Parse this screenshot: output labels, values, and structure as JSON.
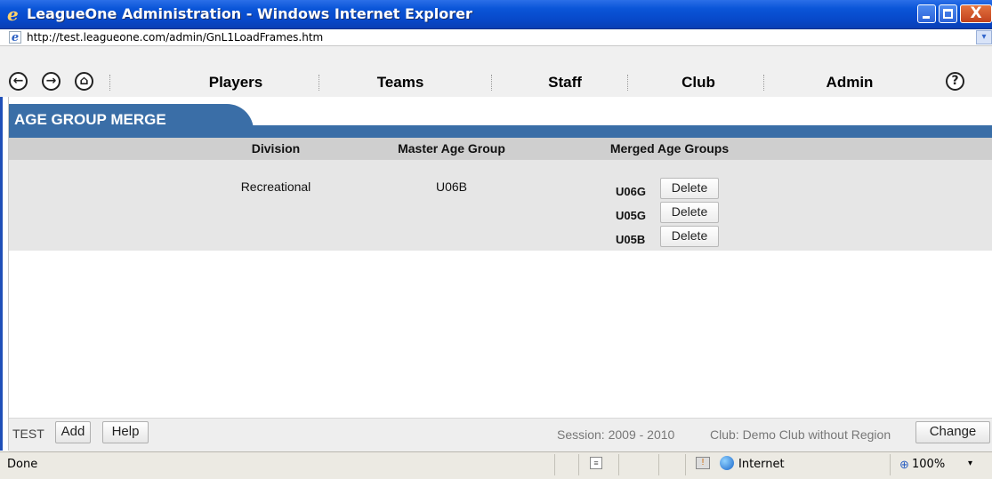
{
  "window": {
    "title": "LeagueOne Administration - Windows Internet Explorer",
    "close_glyph": "X"
  },
  "address": {
    "url": "http://test.leagueone.com/admin/GnL1LoadFrames.htm"
  },
  "nav": {
    "items": [
      {
        "label": "Players"
      },
      {
        "label": "Teams"
      },
      {
        "label": "Staff"
      },
      {
        "label": "Club"
      },
      {
        "label": "Admin"
      }
    ],
    "back_glyph": "←",
    "forward_glyph": "→",
    "home_glyph": "⌂",
    "help_glyph": "?"
  },
  "page": {
    "title": "AGE GROUP MERGE"
  },
  "table": {
    "headers": {
      "division": "Division",
      "master": "Master Age Group",
      "merged": "Merged Age Groups"
    },
    "rows": [
      {
        "division": "Recreational",
        "master": "U06B",
        "merged": [
          {
            "code": "U06G",
            "action": "Delete"
          },
          {
            "code": "U05G",
            "action": "Delete"
          },
          {
            "code": "U05B",
            "action": "Delete"
          }
        ]
      }
    ]
  },
  "footer": {
    "test_label": "TEST",
    "add_label": "Add",
    "help_label": "Help",
    "session": "Session: 2009 - 2010",
    "club": "Club: Demo Club without Region",
    "change_label": "Change"
  },
  "status": {
    "text": "Done",
    "zone": "Internet",
    "zoom": "100%"
  },
  "colors": {
    "title_bar": "#0a55d8",
    "page_header": "#3a6ea7",
    "table_header": "#cfcfcf",
    "table_body": "#e6e6e6"
  }
}
